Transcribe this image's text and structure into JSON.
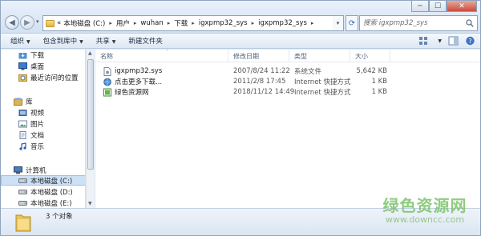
{
  "window": {
    "controls": {
      "minimize": "─",
      "maximize": "☐",
      "close": "✕"
    }
  },
  "address": {
    "prefix": "«",
    "crumbs": [
      "本地磁盘 (C:)",
      "用户",
      "wuhan",
      "下载",
      "igxpmp32_sys",
      "igxpmp32_sys"
    ]
  },
  "search": {
    "placeholder": "搜索 igxpmp32_sys"
  },
  "toolbar": {
    "organize": "组织",
    "include_in_library": "包含到库中",
    "share": "共享",
    "new_folder": "新建文件夹"
  },
  "nav": {
    "favorites": [
      {
        "label": "下载",
        "icon": "download-folder-icon"
      },
      {
        "label": "桌面",
        "icon": "desktop-icon"
      },
      {
        "label": "最近访问的位置",
        "icon": "recent-places-icon"
      }
    ],
    "libraries": {
      "label": "库",
      "items": [
        {
          "label": "视频",
          "icon": "video-library-icon"
        },
        {
          "label": "图片",
          "icon": "picture-library-icon"
        },
        {
          "label": "文档",
          "icon": "document-library-icon"
        },
        {
          "label": "音乐",
          "icon": "music-library-icon"
        }
      ]
    },
    "computer": {
      "label": "计算机",
      "drives": [
        {
          "label": "本地磁盘 (C:)"
        },
        {
          "label": "本地磁盘 (D:)"
        },
        {
          "label": "本地磁盘 (E:)"
        }
      ]
    }
  },
  "columns": {
    "name": "名称",
    "modified": "修改日期",
    "type": "类型",
    "size": "大小"
  },
  "files": [
    {
      "name": "igxpmp32.sys",
      "modified": "2007/8/24 11:22",
      "type": "系统文件",
      "size": "5,642 KB",
      "icon": "system-file-icon"
    },
    {
      "name": "点击更多下载...",
      "modified": "2011/2/8 17:45",
      "type": "Internet 快捷方式",
      "size": "1 KB",
      "icon": "internet-shortcut-icon"
    },
    {
      "name": "绿色资源网",
      "modified": "2018/11/12 14:49",
      "type": "Internet 快捷方式",
      "size": "1 KB",
      "icon": "green-site-shortcut-icon"
    }
  ],
  "status": {
    "text": "3 个对象"
  },
  "watermark": {
    "title": "绿色资源网",
    "url": "www.downcc.com"
  }
}
